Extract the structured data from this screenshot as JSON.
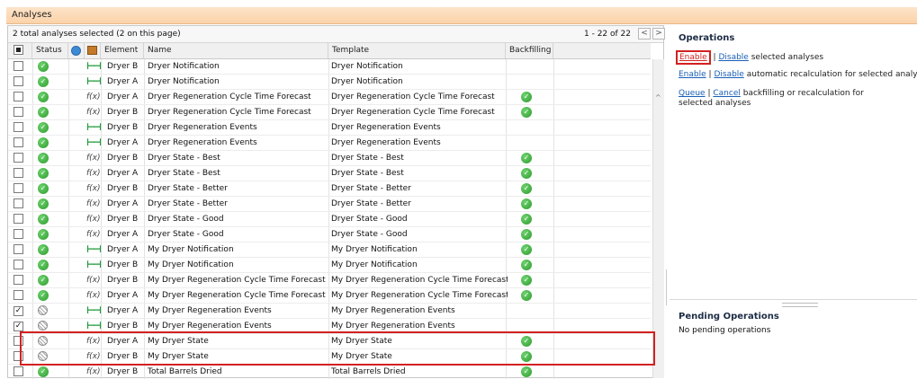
{
  "panel_title": "Analyses",
  "selection_text": "2 total analyses selected (2 on this page)",
  "pager": {
    "range": "1 - 22 of 22",
    "prev": "<",
    "next": ">"
  },
  "columns": {
    "status": "Status",
    "element": "Element",
    "name": "Name",
    "template": "Template",
    "backfilling": "Backfilling"
  },
  "rows": [
    {
      "checked": false,
      "status": "ok",
      "type": "event",
      "element": "Dryer B",
      "name": "Dryer Notification",
      "template": "Dryer Notification",
      "backfill": false
    },
    {
      "checked": false,
      "status": "ok",
      "type": "event",
      "element": "Dryer A",
      "name": "Dryer Notification",
      "template": "Dryer Notification",
      "backfill": false
    },
    {
      "checked": false,
      "status": "ok",
      "type": "calc",
      "element": "Dryer A",
      "name": "Dryer Regeneration Cycle Time Forecast",
      "template": "Dryer Regeneration Cycle Time Forecast",
      "backfill": true
    },
    {
      "checked": false,
      "status": "ok",
      "type": "calc",
      "element": "Dryer B",
      "name": "Dryer Regeneration Cycle Time Forecast",
      "template": "Dryer Regeneration Cycle Time Forecast",
      "backfill": true
    },
    {
      "checked": false,
      "status": "ok",
      "type": "event",
      "element": "Dryer B",
      "name": "Dryer Regeneration Events",
      "template": "Dryer Regeneration Events",
      "backfill": false
    },
    {
      "checked": false,
      "status": "ok",
      "type": "event",
      "element": "Dryer A",
      "name": "Dryer Regeneration Events",
      "template": "Dryer Regeneration Events",
      "backfill": false
    },
    {
      "checked": false,
      "status": "ok",
      "type": "calc",
      "element": "Dryer B",
      "name": "Dryer State - Best",
      "template": "Dryer State - Best",
      "backfill": true
    },
    {
      "checked": false,
      "status": "ok",
      "type": "calc",
      "element": "Dryer A",
      "name": "Dryer State - Best",
      "template": "Dryer State - Best",
      "backfill": true
    },
    {
      "checked": false,
      "status": "ok",
      "type": "calc",
      "element": "Dryer B",
      "name": "Dryer State - Better",
      "template": "Dryer State - Better",
      "backfill": true
    },
    {
      "checked": false,
      "status": "ok",
      "type": "calc",
      "element": "Dryer A",
      "name": "Dryer State - Better",
      "template": "Dryer State - Better",
      "backfill": true
    },
    {
      "checked": false,
      "status": "ok",
      "type": "calc",
      "element": "Dryer B",
      "name": "Dryer State - Good",
      "template": "Dryer State - Good",
      "backfill": true
    },
    {
      "checked": false,
      "status": "ok",
      "type": "calc",
      "element": "Dryer A",
      "name": "Dryer State - Good",
      "template": "Dryer State - Good",
      "backfill": true
    },
    {
      "checked": false,
      "status": "ok",
      "type": "event",
      "element": "Dryer A",
      "name": "My Dryer Notification",
      "template": "My Dryer Notification",
      "backfill": true
    },
    {
      "checked": false,
      "status": "ok",
      "type": "event",
      "element": "Dryer B",
      "name": "My Dryer Notification",
      "template": "My Dryer Notification",
      "backfill": true
    },
    {
      "checked": false,
      "status": "ok",
      "type": "calc",
      "element": "Dryer B",
      "name": "My Dryer Regeneration Cycle Time Forecast",
      "template": "My Dryer Regeneration Cycle Time Forecast",
      "backfill": true
    },
    {
      "checked": false,
      "status": "ok",
      "type": "calc",
      "element": "Dryer A",
      "name": "My Dryer Regeneration Cycle Time Forecast",
      "template": "My Dryer Regeneration Cycle Time Forecast",
      "backfill": true
    },
    {
      "checked": true,
      "status": "disabled",
      "type": "event",
      "element": "Dryer A",
      "name": "My Dryer Regeneration Events",
      "template": "My Dryer Regeneration Events",
      "backfill": false
    },
    {
      "checked": true,
      "status": "disabled",
      "type": "event",
      "element": "Dryer B",
      "name": "My Dryer Regeneration Events",
      "template": "My Dryer Regeneration Events",
      "backfill": false
    },
    {
      "checked": false,
      "status": "disabled",
      "type": "calc",
      "element": "Dryer A",
      "name": "My Dryer State",
      "template": "My Dryer State",
      "backfill": true
    },
    {
      "checked": false,
      "status": "disabled",
      "type": "calc",
      "element": "Dryer B",
      "name": "My Dryer State",
      "template": "My Dryer State",
      "backfill": true
    },
    {
      "checked": false,
      "status": "ok",
      "type": "calc",
      "element": "Dryer B",
      "name": "Total Barrels Dried",
      "template": "Total Barrels Dried",
      "backfill": true
    }
  ],
  "operations": {
    "title": "Operations",
    "line1": {
      "enable": "Enable",
      "sep": "|",
      "disable": "Disable",
      "rest": "selected analyses"
    },
    "line2": {
      "enable": "Enable",
      "sep": "|",
      "disable": "Disable",
      "rest": "automatic recalculation for selected analyses"
    },
    "line3": {
      "queue": "Queue",
      "sep": "|",
      "cancel": "Cancel",
      "rest": "backfilling or recalculation for selected analyses"
    }
  },
  "pending": {
    "title": "Pending Operations",
    "text": "No pending operations"
  },
  "colors": {
    "accent_red": "#d32020",
    "link_blue": "#1a5fb4",
    "ok_green": "#2c9a2c",
    "header_orange": "#fbd3a9"
  }
}
